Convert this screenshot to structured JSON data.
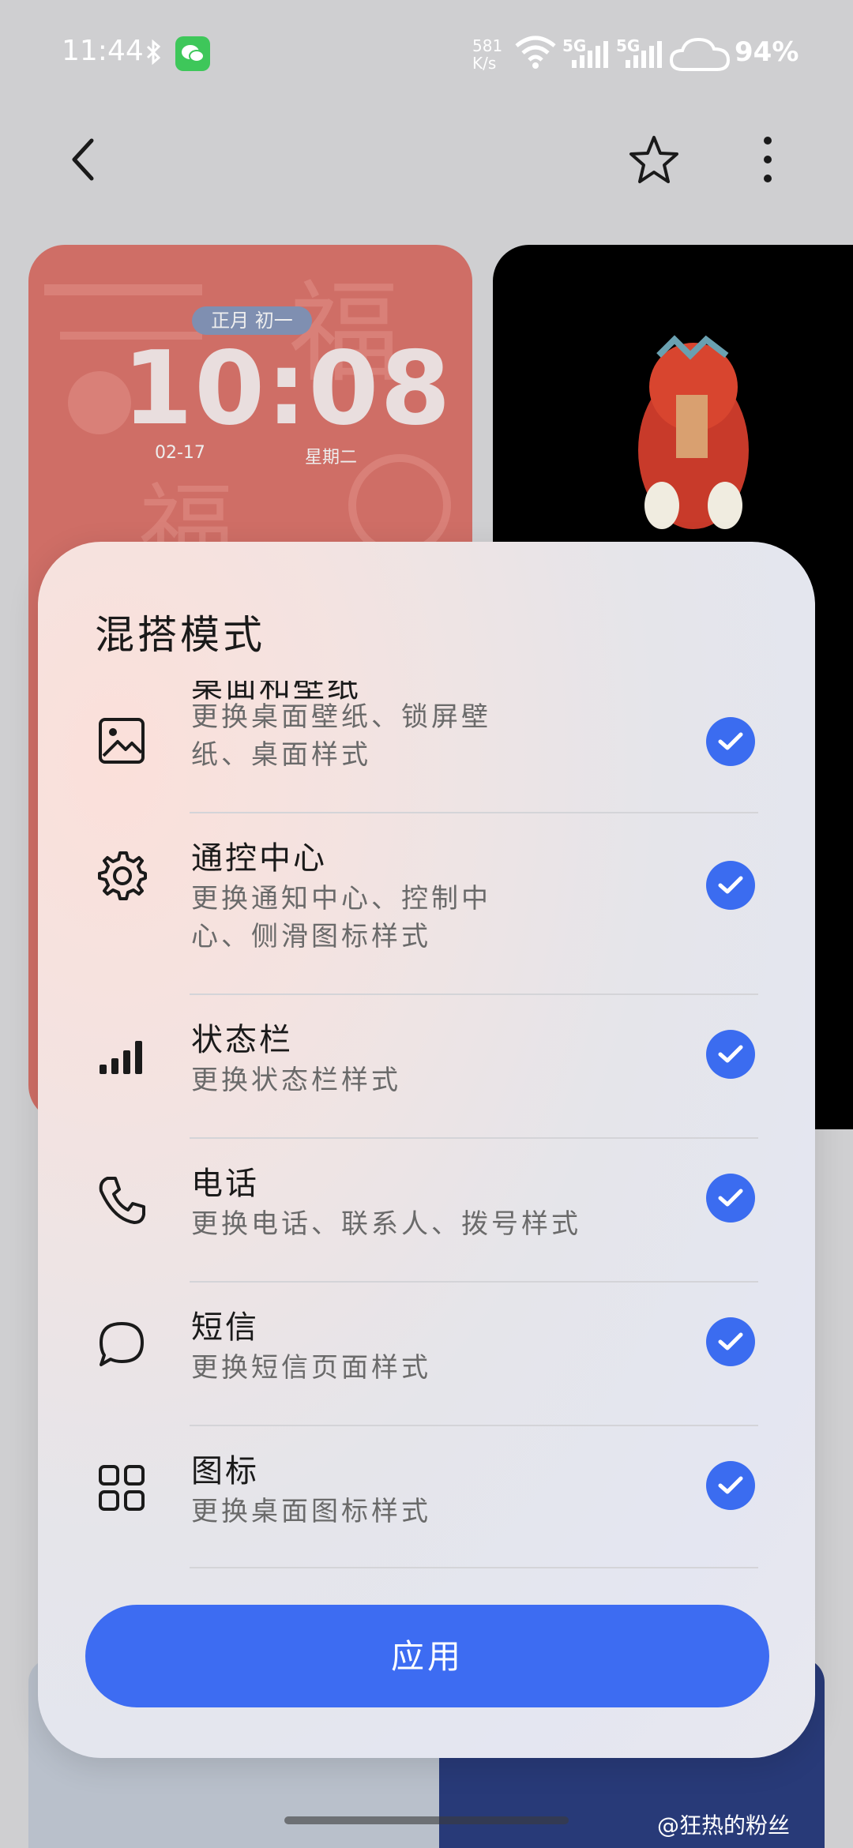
{
  "status_bar": {
    "time": "11:44",
    "net_speed_value": "581",
    "net_speed_unit": "K/s",
    "sim1": "5G",
    "sim2": "5G",
    "battery": "94%"
  },
  "preview": {
    "lunar_date": "正月 初一",
    "clock": "10:08",
    "date": "02-17",
    "weekday": "星期二"
  },
  "sheet": {
    "title": "混搭模式",
    "options": [
      {
        "title": "桌面和壁纸",
        "desc": "更换桌面壁纸、锁屏壁纸、桌面样式",
        "checked": true,
        "icon": "wallpaper-icon"
      },
      {
        "title": "通控中心",
        "desc": "更换通知中心、控制中心、侧滑图标样式",
        "checked": true,
        "icon": "gear-icon"
      },
      {
        "title": "状态栏",
        "desc": "更换状态栏样式",
        "checked": true,
        "icon": "signal-bars-icon"
      },
      {
        "title": "电话",
        "desc": "更换电话、联系人、拨号样式",
        "checked": true,
        "icon": "phone-icon"
      },
      {
        "title": "短信",
        "desc": "更换短信页面样式",
        "checked": true,
        "icon": "message-icon"
      },
      {
        "title": "图标",
        "desc": "更换桌面图标样式",
        "checked": true,
        "icon": "grid-icon"
      }
    ],
    "apply_label": "应用"
  },
  "watermark": "@狂热的粉丝",
  "colors": {
    "accent": "#3d6cf2",
    "check": "#3b6cf0"
  }
}
